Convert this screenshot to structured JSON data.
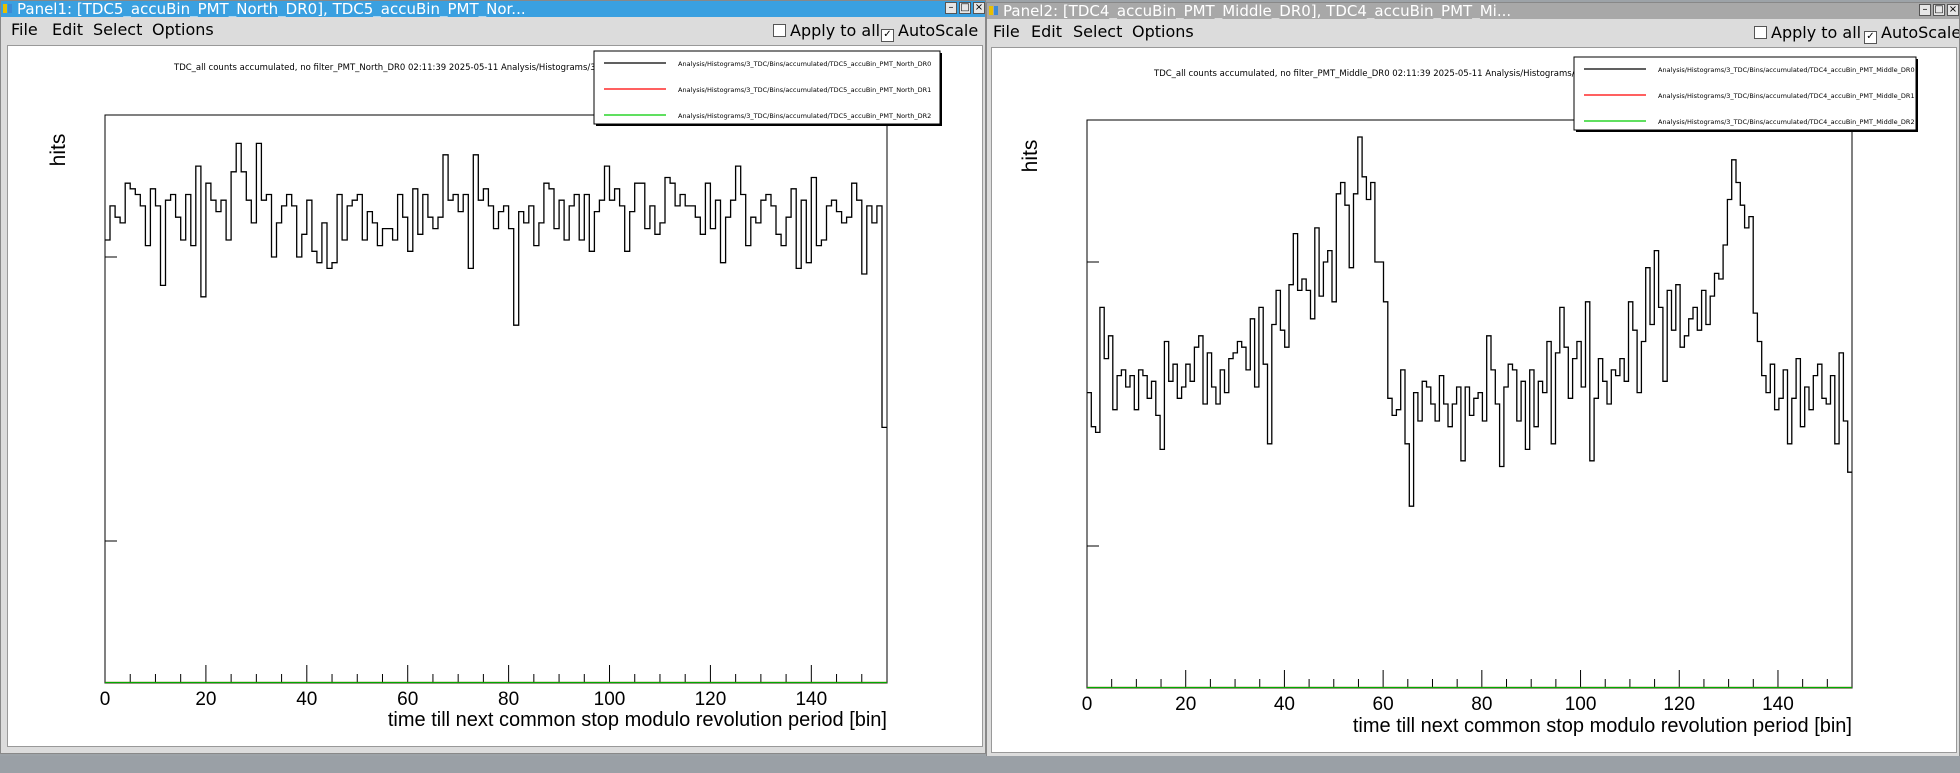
{
  "panels": [
    {
      "title": "Panel1: [TDC5_accuBin_PMT_North_DR0], TDC5_accuBin_PMT_Nor...",
      "menu": [
        "File",
        "Edit",
        "Select",
        "Options"
      ],
      "apply_to_all": "Apply to all",
      "autoscale": "AutoScale",
      "apply_checked": false,
      "autoscale_checked": true,
      "header": "TDC_all counts accumulated, no filter_PMT_North_DR0  02:11:39  2025-05-11  Analysis/Histograms/3_T",
      "legend": [
        {
          "label": "Analysis/Histograms/3_TDC/Bins/accumulated/TDC5_accuBin_PMT_North_DR0",
          "color": "#000000"
        },
        {
          "label": "Analysis/Histograms/3_TDC/Bins/accumulated/TDC5_accuBin_PMT_North_DR1",
          "color": "#ff0000"
        },
        {
          "label": "Analysis/Histograms/3_TDC/Bins/accumulated/TDC5_accuBin_PMT_North_DR2",
          "color": "#00cc00"
        }
      ],
      "chart_data": {
        "type": "line",
        "xlabel": "time till next common stop modulo revolution period [bin]",
        "ylabel": "hits",
        "xlim": [
          0,
          155
        ],
        "ylim": [
          0,
          1
        ],
        "xticks": [
          0,
          20,
          40,
          60,
          80,
          100,
          120,
          140
        ],
        "series": [
          {
            "color": "#000000",
            "values": [
              0.78,
              0.84,
              0.82,
              0.81,
              0.88,
              0.87,
              0.86,
              0.84,
              0.77,
              0.87,
              0.84,
              0.7,
              0.85,
              0.86,
              0.82,
              0.78,
              0.86,
              0.77,
              0.91,
              0.68,
              0.88,
              0.85,
              0.83,
              0.85,
              0.78,
              0.9,
              0.95,
              0.9,
              0.85,
              0.81,
              0.95,
              0.85,
              0.86,
              0.75,
              0.81,
              0.84,
              0.86,
              0.84,
              0.75,
              0.79,
              0.85,
              0.76,
              0.74,
              0.81,
              0.73,
              0.74,
              0.86,
              0.78,
              0.84,
              0.85,
              0.86,
              0.78,
              0.83,
              0.81,
              0.77,
              0.8,
              0.8,
              0.78,
              0.86,
              0.82,
              0.76,
              0.87,
              0.79,
              0.86,
              0.82,
              0.8,
              0.82,
              0.93,
              0.85,
              0.86,
              0.83,
              0.86,
              0.73,
              0.93,
              0.85,
              0.87,
              0.84,
              0.8,
              0.83,
              0.84,
              0.8,
              0.63,
              0.83,
              0.81,
              0.84,
              0.77,
              0.81,
              0.88,
              0.87,
              0.8,
              0.85,
              0.78,
              0.84,
              0.86,
              0.78,
              0.86,
              0.76,
              0.83,
              0.85,
              0.91,
              0.85,
              0.87,
              0.84,
              0.76,
              0.83,
              0.88,
              0.88,
              0.8,
              0.84,
              0.79,
              0.81,
              0.89,
              0.88,
              0.84,
              0.86,
              0.84,
              0.84,
              0.82,
              0.79,
              0.88,
              0.8,
              0.85,
              0.74,
              0.82,
              0.85,
              0.91,
              0.86,
              0.77,
              0.82,
              0.81,
              0.85,
              0.86,
              0.84,
              0.79,
              0.77,
              0.82,
              0.87,
              0.73,
              0.85,
              0.74,
              0.89,
              0.77,
              0.78,
              0.84,
              0.85,
              0.83,
              0.81,
              0.82,
              0.88,
              0.85,
              0.72,
              0.84,
              0.81,
              0.84,
              0.45
            ]
          },
          {
            "color": "#ff0000",
            "values": [
              0,
              0,
              0,
              0,
              0
            ]
          },
          {
            "color": "#00aa00",
            "values": [
              0,
              0,
              0,
              0,
              0
            ]
          }
        ]
      }
    },
    {
      "title": "Panel2: [TDC4_accuBin_PMT_Middle_DR0], TDC4_accuBin_PMT_Mi...",
      "menu": [
        "File",
        "Edit",
        "Select",
        "Options"
      ],
      "apply_to_all": "Apply to all",
      "autoscale": "AutoScale",
      "apply_checked": false,
      "autoscale_checked": true,
      "header": "TDC_all counts accumulated, no filter_PMT_Middle_DR0  02:11:39  2025-05-11  Analysis/Histograms/3_T",
      "legend": [
        {
          "label": "Analysis/Histograms/3_TDC/Bins/accumulated/TDC4_accuBin_PMT_Middle_DR0",
          "color": "#000000"
        },
        {
          "label": "Analysis/Histograms/3_TDC/Bins/accumulated/TDC4_accuBin_PMT_Middle_DR1",
          "color": "#ff0000"
        },
        {
          "label": "Analysis/Histograms/3_TDC/Bins/accumulated/TDC4_accuBin_PMT_Middle_DR2",
          "color": "#00cc00"
        }
      ],
      "chart_data": {
        "type": "line",
        "xlabel": "time till next common stop modulo revolution period [bin]",
        "ylabel": "hits",
        "xlim": [
          0,
          155
        ],
        "ylim": [
          0,
          1
        ],
        "xticks": [
          0,
          20,
          40,
          60,
          80,
          100,
          120,
          140
        ],
        "series": [
          {
            "color": "#000000",
            "values": [
              0.52,
              0.46,
              0.45,
              0.67,
              0.58,
              0.62,
              0.49,
              0.55,
              0.56,
              0.53,
              0.55,
              0.49,
              0.56,
              0.55,
              0.51,
              0.54,
              0.48,
              0.42,
              0.61,
              0.54,
              0.57,
              0.51,
              0.53,
              0.57,
              0.54,
              0.6,
              0.62,
              0.5,
              0.59,
              0.53,
              0.5,
              0.56,
              0.52,
              0.58,
              0.59,
              0.61,
              0.6,
              0.56,
              0.65,
              0.53,
              0.67,
              0.57,
              0.43,
              0.64,
              0.7,
              0.63,
              0.6,
              0.71,
              0.8,
              0.7,
              0.72,
              0.7,
              0.65,
              0.81,
              0.69,
              0.75,
              0.77,
              0.68,
              0.87,
              0.89,
              0.85,
              0.74,
              0.87,
              0.97,
              0.9,
              0.86,
              0.89,
              0.75,
              0.75,
              0.68,
              0.51,
              0.48,
              0.49,
              0.56,
              0.43,
              0.32,
              0.52,
              0.47,
              0.54,
              0.53,
              0.5,
              0.47,
              0.55,
              0.5,
              0.46,
              0.5,
              0.53,
              0.4,
              0.53,
              0.48,
              0.51,
              0.52,
              0.47,
              0.62,
              0.56,
              0.5,
              0.39,
              0.53,
              0.57,
              0.56,
              0.47,
              0.54,
              0.42,
              0.56,
              0.46,
              0.54,
              0.52,
              0.61,
              0.43,
              0.59,
              0.67,
              0.6,
              0.51,
              0.58,
              0.61,
              0.53,
              0.68,
              0.4,
              0.51,
              0.58,
              0.54,
              0.5,
              0.56,
              0.55,
              0.58,
              0.54,
              0.68,
              0.63,
              0.52,
              0.61,
              0.74,
              0.64,
              0.77,
              0.67,
              0.54,
              0.7,
              0.63,
              0.71,
              0.6,
              0.62,
              0.65,
              0.67,
              0.63,
              0.7,
              0.64,
              0.69,
              0.73,
              0.72,
              0.78,
              0.86,
              0.93,
              0.89,
              0.85,
              0.81,
              0.83,
              0.66,
              0.61,
              0.55,
              0.52,
              0.57,
              0.49,
              0.51,
              0.56,
              0.43,
              0.51,
              0.58,
              0.46,
              0.53,
              0.49,
              0.55,
              0.57,
              0.51,
              0.5,
              0.55,
              0.43,
              0.59,
              0.47,
              0.38
            ]
          },
          {
            "color": "#ff0000",
            "values": [
              0,
              0,
              0,
              0,
              0
            ]
          },
          {
            "color": "#00aa00",
            "values": [
              0,
              0,
              0,
              0,
              0
            ]
          }
        ]
      }
    }
  ]
}
